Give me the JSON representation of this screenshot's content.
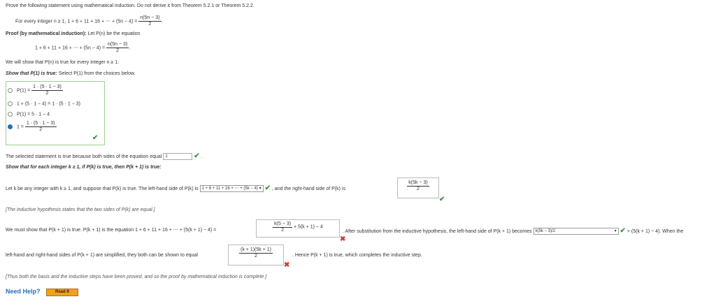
{
  "problem": {
    "instruction": "Prove the following statement using mathematical induction. Do not derive it from Theorem 5.2.1 or Theorem 5.2.2.",
    "statement_prefix": "For every integer n ≥ 1, 1 + 6 + 11 + 16 + ⋯ + (5n − 4) =",
    "statement_num": "n(5n − 3)",
    "statement_den": "2"
  },
  "proof": {
    "heading": "Proof (by mathematical induction):",
    "heading_rest": "Let P(n) be the equation",
    "eq_left": "1 + 6 + 11 + 16 + ⋯ + (5n − 4) =",
    "eq_num": "n(5n − 3)",
    "eq_den": "2",
    "show_line": "We will show that P(n) is true for every integer n ≥ 1."
  },
  "basis": {
    "heading": "Show that P(1) is true:",
    "heading_rest": "Select P(1) from the choices below.",
    "choices": [
      {
        "left": "P(1) =",
        "num": "1 · (5 · 1 − 3)",
        "den": "2",
        "selected": false
      },
      {
        "left": "1 + (5 · 1 − 4) = 1 · (5 · 1 − 3)",
        "selected": false
      },
      {
        "left": "P(1) = 5 · 1 − 4",
        "selected": false
      },
      {
        "left": "1 =",
        "num": "1 · (5 · 1 − 3)",
        "den": "2",
        "selected": true
      }
    ],
    "selected_statement": "The selected statement is true because both sides of the equation equal",
    "equal_value": "1"
  },
  "inductive": {
    "heading": "Show that for each integer k ≥ 1, if P(k) is true, then P(k + 1) is true:",
    "suppose_text": "Let k be any integer with k ≥ 1, and suppose that P(k) is true. The left-hand side of P(k) is",
    "lhs_select": "1 + 6 + 11 + 16 + ⋯ + (5k − 4)",
    "rhs_text": ", and the right-hand side of P(k) is",
    "rhs_num": "k(5k − 3)",
    "rhs_den": "2",
    "hypothesis_note": "[The inductive hypothesis states that the two sides of P(k) are equal.]",
    "must_show": "We must show that P(k + 1) is true. P(k + 1) is the equation 1 + 6 + 11 + 16 + ⋯ + (5(k + 1) − 4) =",
    "answer_num": "k(5 − 3)",
    "answer_den": "2",
    "answer_tail": "+ 5(k + 1) − 4",
    "after_sub": ". After substitution from the inductive hypothesis, the left-hand side of P(k + 1) becomes",
    "after_select": "k(5k − 3)/2",
    "after_tail": "+ (5(k + 1) − 4). When the",
    "sides_text": "left-hand and right-hand sides of P(k + 1) are simplified, they both can be shown to equal",
    "equal_num": "(k + 1)(5k + 1)",
    "equal_den": "2",
    "hence_text": ". Hence P(k + 1) is true, which completes the inductive step.",
    "conclusion": "[Thus both the basis and the inductive steps have been proved, and so the proof by mathematical induction is complete.]"
  },
  "help": {
    "label": "Need Help?",
    "read_button": "Read It"
  }
}
